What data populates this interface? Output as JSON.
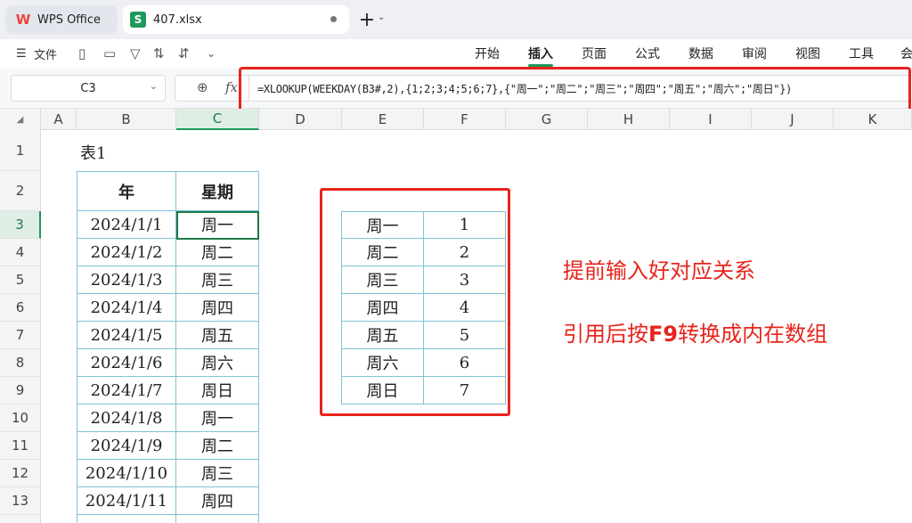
{
  "tabs": {
    "home_label": "WPS Office",
    "file_label": "407.xlsx",
    "new_tab": "+"
  },
  "toolbar": {
    "file_menu": "文件",
    "menus": [
      "开始",
      "插入",
      "页面",
      "公式",
      "数据",
      "审阅",
      "视图",
      "工具",
      "会"
    ],
    "active_menu": "插入"
  },
  "formula_bar": {
    "name_box": "C3",
    "fx": "fx",
    "formula": "=XLOOKUP(WEEKDAY(B3#,2),{1;2;3;4;5;6;7},{\"周一\";\"周二\";\"周三\";\"周四\";\"周五\";\"周六\";\"周日\"})"
  },
  "columns": [
    "A",
    "B",
    "C",
    "D",
    "E",
    "F",
    "G",
    "H",
    "I",
    "J",
    "K"
  ],
  "selected_column": "C",
  "rows": [
    "1",
    "2",
    "3",
    "4",
    "5",
    "6",
    "7",
    "8",
    "9",
    "10",
    "11",
    "12",
    "13"
  ],
  "selected_row": "3",
  "sheet": {
    "table_title": "表1",
    "headers": [
      "年",
      "星期"
    ],
    "dates": [
      "2024/1/1",
      "2024/1/2",
      "2024/1/3",
      "2024/1/4",
      "2024/1/5",
      "2024/1/6",
      "2024/1/7",
      "2024/1/8",
      "2024/1/9",
      "2024/1/10",
      "2024/1/11"
    ],
    "weekdays": [
      "周一",
      "周二",
      "周三",
      "周四",
      "周五",
      "周六",
      "周日",
      "周一",
      "周二",
      "周三",
      "周四"
    ],
    "lookup": [
      {
        "name": "周一",
        "num": "1"
      },
      {
        "name": "周二",
        "num": "2"
      },
      {
        "name": "周三",
        "num": "3"
      },
      {
        "name": "周四",
        "num": "4"
      },
      {
        "name": "周五",
        "num": "5"
      },
      {
        "name": "周六",
        "num": "6"
      },
      {
        "name": "周日",
        "num": "7"
      }
    ]
  },
  "annotations": {
    "line1": "提前输入好对应关系",
    "line2_prefix": "引用后按",
    "line2_key": "F9",
    "line2_suffix": "转换成内在数组"
  },
  "colors": {
    "accent": "#1d9a5b",
    "annotation_red": "#e8241c",
    "table_border": "#7fc3d8"
  }
}
